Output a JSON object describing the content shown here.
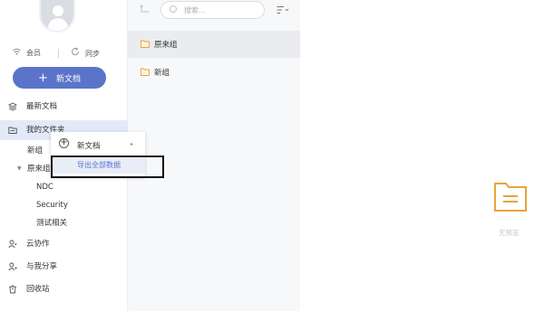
{
  "sidebar": {
    "member_label": "会员",
    "sync_label": "同步",
    "new_doc_label": "新文档",
    "nav": {
      "recent": "最新文档",
      "my_folder": "我的文件夹",
      "cloud": "云协作",
      "shared": "与我分享",
      "trash": "回收站"
    },
    "tree": {
      "new_group": "新组",
      "yuanlai_group": "原来组",
      "children": [
        "NDC",
        "Security",
        "测试相关"
      ]
    }
  },
  "toolbar": {
    "search_placeholder": "搜索..."
  },
  "file_list": [
    {
      "name": "原来组"
    },
    {
      "name": "新组"
    }
  ],
  "context_menu": {
    "new_doc": "新文档",
    "export_all": "导出全部数据"
  },
  "preview": {
    "empty_text": "无预览"
  },
  "colors": {
    "accent": "#5b74c9",
    "folder": "#e8a33a",
    "active_bg": "#e3e9f8"
  }
}
